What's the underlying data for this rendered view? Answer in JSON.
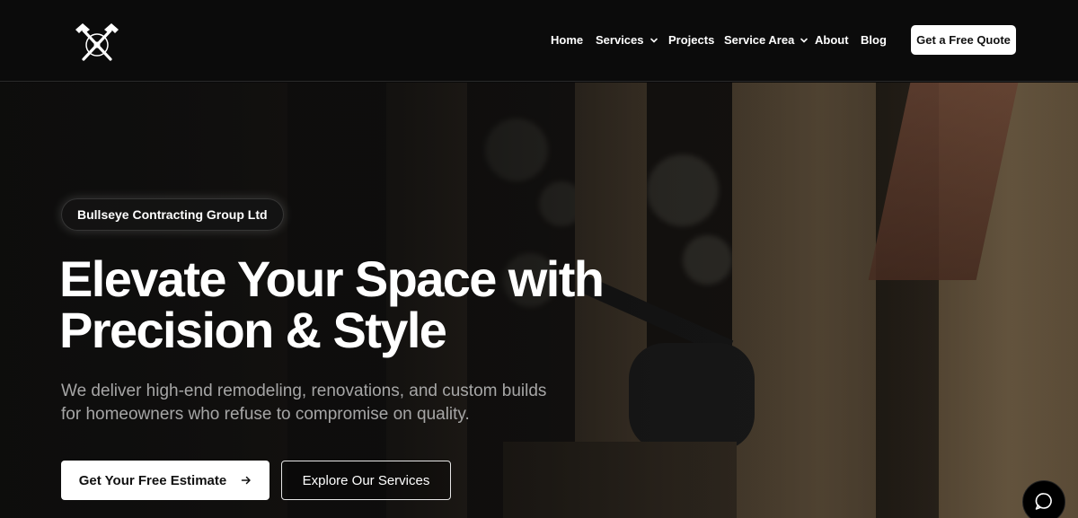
{
  "brand": {
    "logo_icon": "crossed-hammers-icon"
  },
  "nav": {
    "items": [
      {
        "label": "Home",
        "has_dropdown": false
      },
      {
        "label": "Services",
        "has_dropdown": true
      },
      {
        "label": "Projects",
        "has_dropdown": false
      },
      {
        "label": "Service Area",
        "has_dropdown": true
      },
      {
        "label": "About",
        "has_dropdown": false
      },
      {
        "label": "Blog",
        "has_dropdown": false
      }
    ],
    "cta_label": "Get a Free Quote"
  },
  "hero": {
    "badge": "Bullseye Contracting Group Ltd",
    "headline_line1": "Elevate Your Space with",
    "headline_line2": "Precision & Style",
    "subtext_line1": "We deliver high-end remodeling, renovations, and custom builds",
    "subtext_line2": "for homeowners who refuse to compromise on quality.",
    "primary_cta": "Get Your Free Estimate",
    "primary_cta_icon": "arrow-right-icon",
    "secondary_cta": "Explore Our Services"
  },
  "chat": {
    "icon": "chat-bubble-icon"
  },
  "colors": {
    "header_bg": "#0b0b0b",
    "hero_overlay": "#0c0c0c",
    "button_bg": "#ffffff",
    "subtext": "#a6a6a6"
  }
}
